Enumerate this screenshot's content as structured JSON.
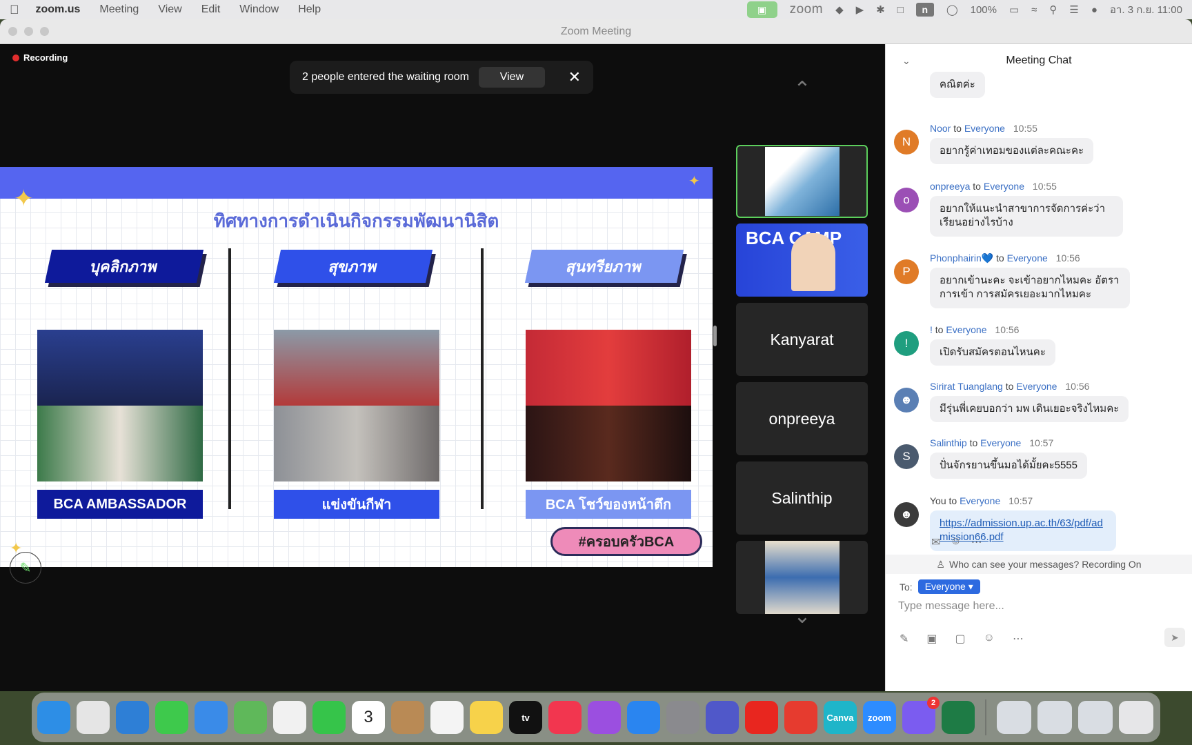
{
  "menubar": {
    "app_name": "zoom.us",
    "items": [
      "Meeting",
      "View",
      "Edit",
      "Window",
      "Help"
    ],
    "zoom_label": "zoom",
    "n_label": "n",
    "battery": "100%",
    "clock": "อา. 3 ก.ย.  11:00"
  },
  "window": {
    "title": "Zoom Meeting"
  },
  "stage": {
    "recording": "Recording",
    "toast": {
      "message": "2 people entered the waiting room",
      "view_label": "View",
      "close": "✕"
    }
  },
  "slide": {
    "heading": "ทิศทางการดำเนินกิจกรรมพัฒนานิสิต",
    "columns": [
      {
        "tag": "บุคลิกภาพ",
        "caption": "BCA AMBASSADOR",
        "tag_color": "#0e1a9b",
        "caption_color": "#0e1a9b"
      },
      {
        "tag": "สุขภาพ",
        "caption": "แข่งขันกีฬา",
        "tag_color": "#2f50e9",
        "caption_color": "#2f50e9"
      },
      {
        "tag": "สุนทรียภาพ",
        "caption": "BCA โชว์ของหน้าตึก",
        "tag_color": "#7b96f2",
        "caption_color": "#7b96f2"
      }
    ],
    "hashtag": "#ครอบครัวBCA"
  },
  "gallery": {
    "tiles": [
      {
        "kind": "image",
        "label": ""
      },
      {
        "kind": "video",
        "label": "BCA CAMP"
      },
      {
        "kind": "name",
        "label": "Kanyarat"
      },
      {
        "kind": "name",
        "label": "onpreeya"
      },
      {
        "kind": "name",
        "label": "Salinthip"
      },
      {
        "kind": "video",
        "label": ""
      }
    ]
  },
  "chat": {
    "title": "Meeting Chat",
    "messages": [
      {
        "sender": "",
        "to": "",
        "recipient": "",
        "time": "",
        "text": "คณิตค่ะ",
        "avatar": "",
        "avatar_color": ""
      },
      {
        "sender": "Noor",
        "to": "to",
        "recipient": "Everyone",
        "time": "10:55",
        "text": "อยากรู้ค่าเทอมของแต่ละคณะคะ",
        "avatar": "N",
        "avatar_color": "#e07b27"
      },
      {
        "sender": "onpreeya",
        "to": "to",
        "recipient": "Everyone",
        "time": "10:55",
        "text": "อยากให้แนะนำสาขาการจัดการค่ะว่าเรียนอย่างไรบ้าง",
        "avatar": "o",
        "avatar_color": "#9b4fb5"
      },
      {
        "sender": "Phonphairin💙",
        "to": "to",
        "recipient": "Everyone",
        "time": "10:56",
        "text": "อยากเข้านะคะ จะเข้าอยากไหมคะ อัตราการเข้า การสมัครเยอะมากไหมคะ",
        "avatar": "P",
        "avatar_color": "#e07b27"
      },
      {
        "sender": "!",
        "to": "to",
        "recipient": "Everyone",
        "time": "10:56",
        "text": "เปิดรับสมัครตอนไหนคะ",
        "avatar": "!",
        "avatar_color": "#1f9e7f"
      },
      {
        "sender": "Sirirat Tuanglang",
        "to": "to",
        "recipient": "Everyone",
        "time": "10:56",
        "text": "มีรุ่นพี่เคยบอกว่า มพ เดินเยอะจริงไหมคะ",
        "avatar": "",
        "avatar_color": "#5a7fb4"
      },
      {
        "sender": "Salinthip",
        "to": "to",
        "recipient": "Everyone",
        "time": "10:57",
        "text": "ปั่นจักรยานขึ้นมอได้มั้ยคะ5555",
        "avatar": "S",
        "avatar_color": "#4a5a6e"
      },
      {
        "sender": "You",
        "to": "to",
        "recipient": "Everyone",
        "time": "10:57",
        "text": "https://admission.up.ac.th/63/pdf/admission66.pdf",
        "avatar": "",
        "avatar_color": "#3b3b3b"
      }
    ],
    "who_sees": "Who can see your messages? Recording On",
    "to_label": "To:",
    "to_value": "Everyone",
    "input_placeholder": "Type message here..."
  },
  "dock": {
    "apps": [
      {
        "name": "Finder",
        "label": "",
        "color": "#2d8ee6"
      },
      {
        "name": "Launchpad",
        "label": "",
        "color": "#e5e5e5"
      },
      {
        "name": "Safari",
        "label": "",
        "color": "#2e7fd6"
      },
      {
        "name": "Messages",
        "label": "",
        "color": "#3ec94c"
      },
      {
        "name": "Mail",
        "label": "",
        "color": "#3a8be8"
      },
      {
        "name": "Maps",
        "label": "",
        "color": "#5fb85a"
      },
      {
        "name": "Photos",
        "label": "",
        "color": "#f1f1f1"
      },
      {
        "name": "FaceTime",
        "label": "",
        "color": "#36c44a"
      },
      {
        "name": "Calendar",
        "label": "3",
        "color": "#ffffff"
      },
      {
        "name": "Contacts",
        "label": "",
        "color": "#b98a55"
      },
      {
        "name": "Reminders",
        "label": "",
        "color": "#f4f4f4"
      },
      {
        "name": "Notes",
        "label": "",
        "color": "#f7d24a"
      },
      {
        "name": "TV",
        "label": "tv",
        "color": "#111111"
      },
      {
        "name": "Music",
        "label": "",
        "color": "#f2364f"
      },
      {
        "name": "Podcasts",
        "label": "",
        "color": "#9b4fe0"
      },
      {
        "name": "App Store",
        "label": "",
        "color": "#2a85f0"
      },
      {
        "name": "System Settings",
        "label": "",
        "color": "#8a8a8e"
      },
      {
        "name": "Teams",
        "label": "",
        "color": "#5058c9"
      },
      {
        "name": "YouTube",
        "label": "",
        "color": "#e8261f"
      },
      {
        "name": "Player",
        "label": "",
        "color": "#e63b2f"
      },
      {
        "name": "Canva",
        "label": "Canva",
        "color": "#1fb5c9"
      },
      {
        "name": "Zoom",
        "label": "zoom",
        "color": "#2d8cff"
      },
      {
        "name": "Messenger",
        "label": "",
        "color": "#7b5cf0",
        "badge": "2"
      },
      {
        "name": "Excel",
        "label": "",
        "color": "#1e7b45"
      }
    ],
    "recent": [
      {
        "name": "Window 1",
        "color": "#d9dde3"
      },
      {
        "name": "Window 2",
        "color": "#d9dde3"
      },
      {
        "name": "Window 3",
        "color": "#d9dde3"
      },
      {
        "name": "Trash",
        "color": "#e6e6e8"
      }
    ]
  }
}
